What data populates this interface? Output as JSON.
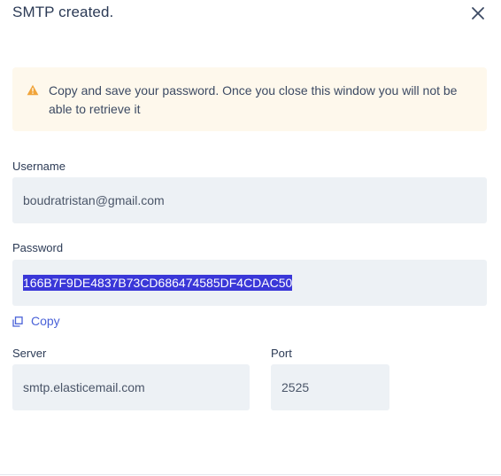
{
  "dialog": {
    "title": "SMTP created.",
    "close_icon": "close-icon"
  },
  "alert": {
    "icon": "warning-triangle-icon",
    "color": "#f0a43a",
    "background": "#fef8ec",
    "message": "Copy and save your password. Once you close this window you will not be able to retrieve it"
  },
  "username": {
    "label": "Username",
    "value": "boudratristan@gmail.com"
  },
  "password": {
    "label": "Password",
    "value": "166B7F9DE4837B73CD686474585DF4CDAC50",
    "selection_color": "#3a37d8"
  },
  "copy": {
    "icon": "copy-icon",
    "label": "Copy",
    "color": "#4a62d8"
  },
  "server": {
    "label": "Server",
    "value": "smtp.elasticemail.com"
  },
  "port": {
    "label": "Port",
    "value": "2525"
  }
}
